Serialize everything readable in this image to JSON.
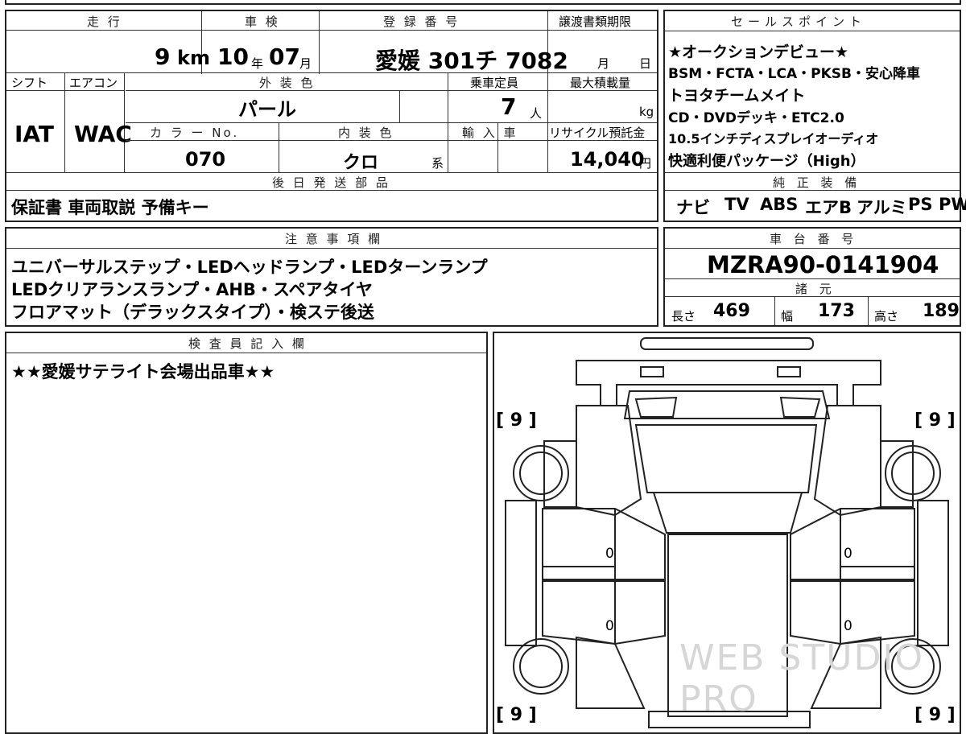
{
  "top_table": {
    "headers": {
      "mileage": "走 行",
      "inspection": "車 検",
      "registration": "登 録 番 号",
      "transfer_deadline": "譲渡書類期限"
    },
    "mileage_value": "9",
    "mileage_unit": "km",
    "inspection_year": "10",
    "inspection_year_unit": "年",
    "inspection_month": "07",
    "inspection_month_unit": "月",
    "registration_value": "愛媛 301チ 7082",
    "transfer_month_unit": "月",
    "transfer_day_unit": "日",
    "headers2": {
      "shift": "シフト",
      "aircon": "エアコン",
      "exterior_color": "外 装 色",
      "capacity": "乗車定員",
      "max_load": "最大積載量"
    },
    "shift_value": "IAT",
    "aircon_value": "WAC",
    "exterior_color_value": "パール",
    "capacity_value": "7",
    "capacity_unit": "人",
    "max_load_unit": "kg",
    "headers3": {
      "color_no": "カ ラ ー No.",
      "interior_color": "内 装 色",
      "import": "輸 入 車",
      "recycle": "リサイクル預託金"
    },
    "color_no_value": "070",
    "interior_color_value": "クロ",
    "interior_color_unit": "系",
    "recycle_value": "14,040",
    "recycle_unit": "円",
    "later_parts_header": "後 日 発 送 部 品",
    "later_parts_value": "保証書 車両取説 予備キー"
  },
  "sales_points": {
    "header": "セールスポイント",
    "lines": [
      "★オークションデビュー★",
      "BSM・FCTA・LCA・PKSB・安心降車",
      "トヨタチームメイト",
      "CD・DVDデッキ・ETC2.0",
      "10.5インチディスプレイオーディオ",
      "快適利便パッケージ（High）"
    ],
    "equipment_header": "純 正 装 備",
    "equipment": [
      "ナビ",
      "TV",
      "ABS",
      "エアB",
      "アルミ",
      "PS",
      "PW"
    ]
  },
  "notes": {
    "header": "注 意 事 項 欄",
    "lines": [
      "ユニバーサルステップ・LEDヘッドランプ・LEDターンランプ",
      "LEDクリアランスランプ・AHB・スペアタイヤ",
      "フロアマット（デラックスタイプ）・検ステ後送"
    ]
  },
  "chassis": {
    "header": "車 台 番 号",
    "value": "MZRA90-0141904",
    "spec_header": "諸 元",
    "length_label": "長さ",
    "length_value": "469",
    "width_label": "幅",
    "width_value": "173",
    "height_label": "高さ",
    "height_value": "189"
  },
  "inspector": {
    "header": "検 査 員 記 入 欄",
    "comment": "★★愛媛サテライト会場出品車★★"
  },
  "diagram": {
    "tire_fl": "[ 9 ]",
    "tire_fr": "[ 9 ]",
    "tire_rl": "[ 9 ]",
    "tire_rr": "[ 9 ]",
    "door_fl": "0",
    "door_rl": "0",
    "door_fr": "0",
    "door_rr": "0",
    "watermark": "WEB STUDIO PRO"
  }
}
